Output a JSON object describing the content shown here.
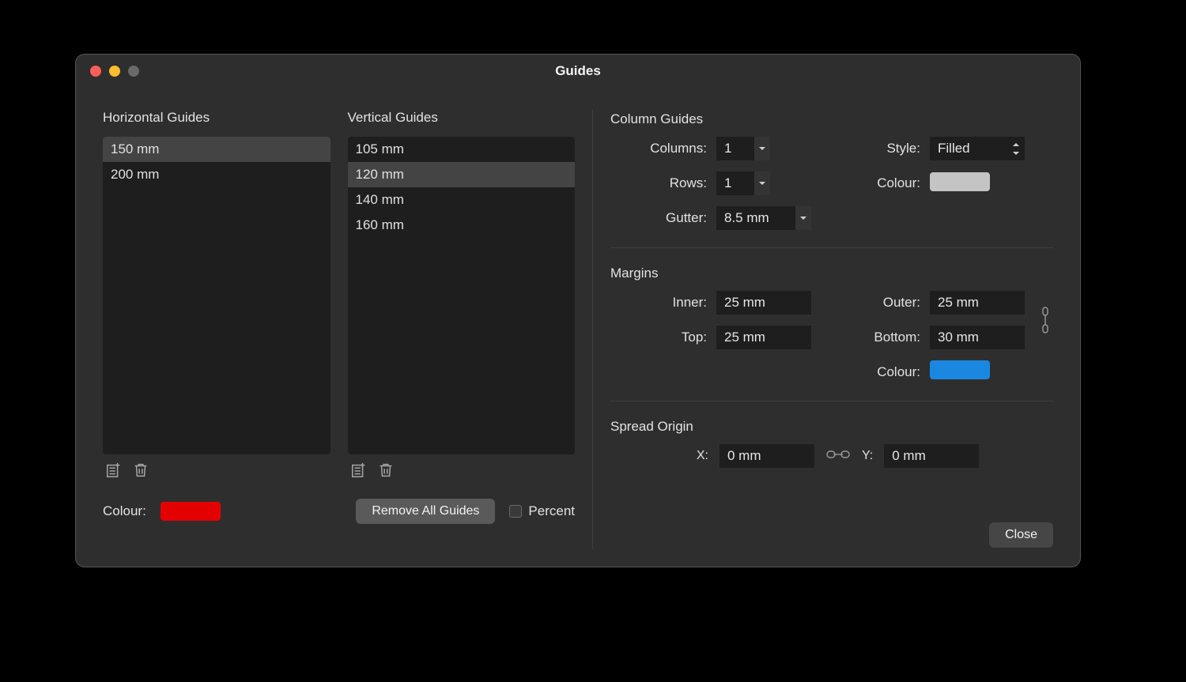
{
  "window": {
    "title": "Guides"
  },
  "horizontal": {
    "heading": "Horizontal Guides",
    "items": [
      "150 mm",
      "200 mm"
    ],
    "selected_index": 0
  },
  "vertical": {
    "heading": "Vertical Guides",
    "items": [
      "105 mm",
      "120 mm",
      "140 mm",
      "160 mm"
    ],
    "selected_index": 1
  },
  "guides_colour": {
    "label": "Colour:",
    "hex": "#e50000"
  },
  "remove_all_label": "Remove All Guides",
  "percent_label": "Percent",
  "column_guides": {
    "heading": "Column Guides",
    "columns_label": "Columns:",
    "columns_value": "1",
    "rows_label": "Rows:",
    "rows_value": "1",
    "gutter_label": "Gutter:",
    "gutter_value": "8.5 mm",
    "style_label": "Style:",
    "style_value": "Filled",
    "colour_label": "Colour:",
    "colour_hex": "#c4c4c4"
  },
  "margins": {
    "heading": "Margins",
    "inner_label": "Inner:",
    "inner_value": "25 mm",
    "outer_label": "Outer:",
    "outer_value": "25 mm",
    "top_label": "Top:",
    "top_value": "25 mm",
    "bottom_label": "Bottom:",
    "bottom_value": "30 mm",
    "colour_label": "Colour:",
    "colour_hex": "#1a88e0"
  },
  "spread": {
    "heading": "Spread Origin",
    "x_label": "X:",
    "x_value": "0 mm",
    "y_label": "Y:",
    "y_value": "0 mm"
  },
  "close_label": "Close"
}
